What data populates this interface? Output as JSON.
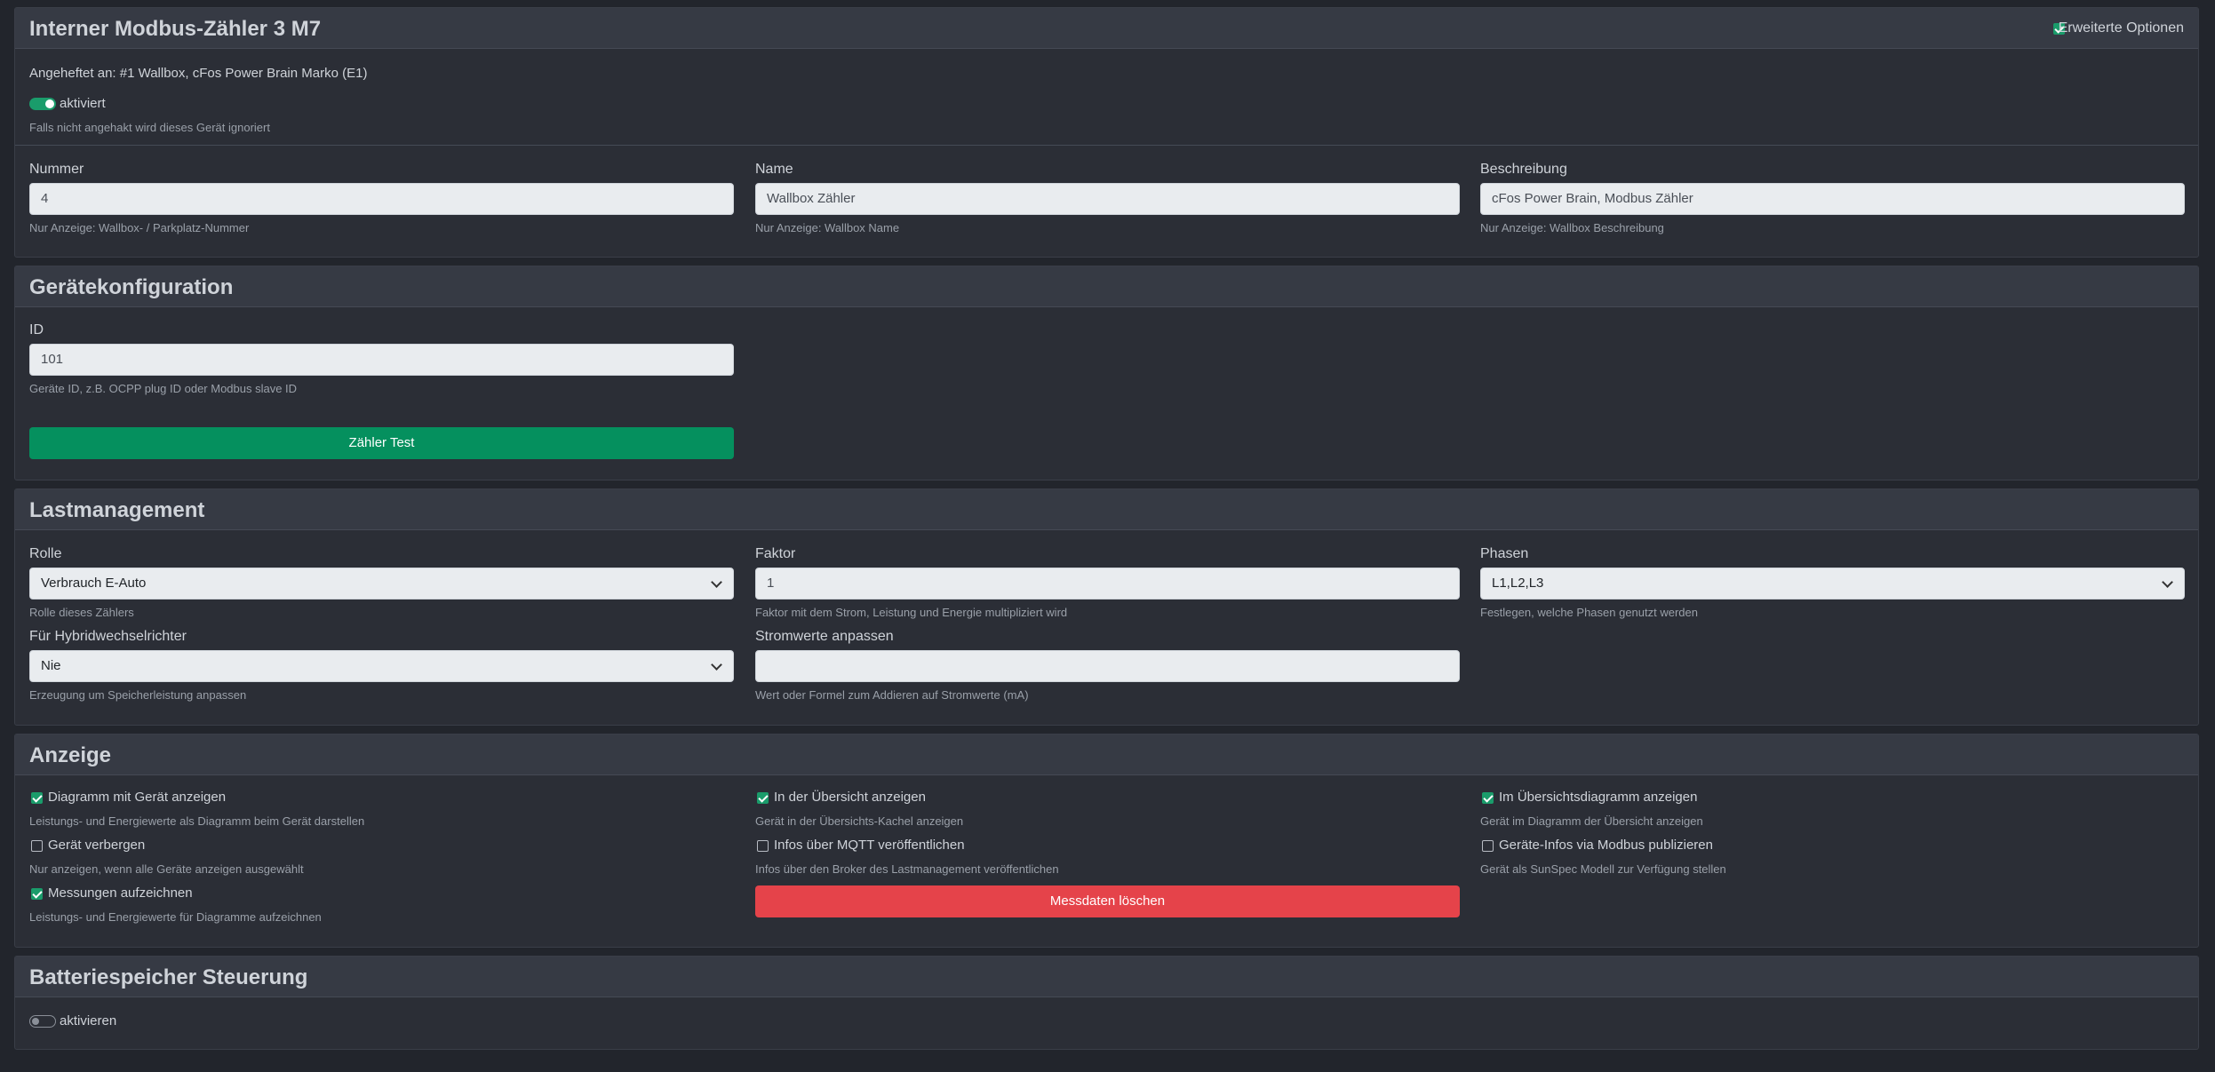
{
  "device": {
    "title": "Interner Modbus-Zähler 3 M7",
    "advanced_options_label": "Erweiterte Optionen",
    "attached_text": "Angeheftet an: #1 Wallbox, cFos Power Brain Marko (E1)",
    "enabled_label": "aktiviert",
    "enabled_help": "Falls nicht angehakt wird dieses Gerät ignoriert",
    "number": {
      "label": "Nummer",
      "value": "4",
      "help": "Nur Anzeige: Wallbox- / Parkplatz-Nummer"
    },
    "name": {
      "label": "Name",
      "value": "Wallbox Zähler",
      "help": "Nur Anzeige: Wallbox Name"
    },
    "description": {
      "label": "Beschreibung",
      "value": "cFos Power Brain, Modbus Zähler",
      "help": "Nur Anzeige: Wallbox Beschreibung"
    }
  },
  "device_config": {
    "title": "Gerätekonfiguration",
    "id": {
      "label": "ID",
      "value": "101",
      "help": "Geräte ID, z.B. OCPP plug ID oder Modbus slave ID"
    },
    "test_button": "Zähler Test"
  },
  "load_management": {
    "title": "Lastmanagement",
    "role": {
      "label": "Rolle",
      "value": "Verbrauch E-Auto",
      "help": "Rolle dieses Zählers"
    },
    "factor": {
      "label": "Faktor",
      "value": "1",
      "help": "Faktor mit dem Strom, Leistung und Energie multipliziert wird"
    },
    "phases": {
      "label": "Phasen",
      "value": "L1,L2,L3",
      "help": "Festlegen, welche Phasen genutzt werden"
    },
    "hybrid": {
      "label": "Für Hybridwechselrichter",
      "value": "Nie",
      "help": "Erzeugung um Speicherleistung anpassen"
    },
    "current_adjust": {
      "label": "Stromwerte anpassen",
      "value": "",
      "help": "Wert oder Formel zum Addieren auf Stromwerte (mA)"
    }
  },
  "display": {
    "title": "Anzeige",
    "options": [
      {
        "label": "Diagramm mit Gerät anzeigen",
        "help": "Leistungs- und Energiewerte als Diagramm beim Gerät darstellen",
        "checked": true
      },
      {
        "label": "In der Übersicht anzeigen",
        "help": "Gerät in der Übersichts-Kachel anzeigen",
        "checked": true
      },
      {
        "label": "Im Übersichtsdiagramm anzeigen",
        "help": "Gerät im Diagramm der Übersicht anzeigen",
        "checked": true
      },
      {
        "label": "Gerät verbergen",
        "help": "Nur anzeigen, wenn alle Geräte anzeigen ausgewählt",
        "checked": false
      },
      {
        "label": "Infos über MQTT veröffentlichen",
        "help": "Infos über den Broker des Lastmanagement veröffentlichen",
        "checked": false
      },
      {
        "label": "Geräte-Infos via Modbus publizieren",
        "help": "Gerät als SunSpec Modell zur Verfügung stellen",
        "checked": false
      },
      {
        "label": "Messungen aufzeichnen",
        "help": "Leistungs- und Energiewerte für Diagramme aufzeichnen",
        "checked": true
      }
    ],
    "delete_button": "Messdaten löschen"
  },
  "battery": {
    "title": "Batteriespeicher Steuerung",
    "enable_label": "aktivieren"
  }
}
